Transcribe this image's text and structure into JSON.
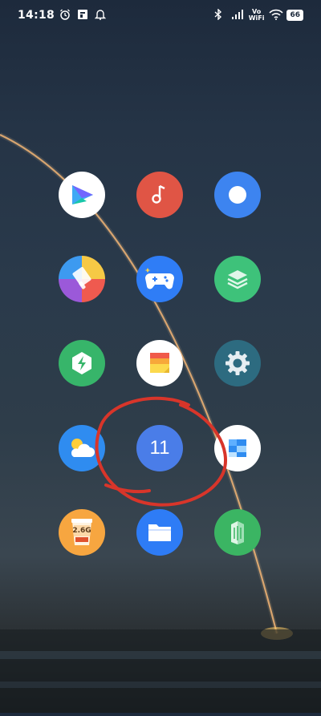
{
  "status_bar": {
    "time": "14:18",
    "vowifi_top": "Vo",
    "vowifi_bottom": "WiFi",
    "battery": "66"
  },
  "home": {
    "app_count": 15
  },
  "apps": {
    "calendar_date": "11",
    "cleaner_size": "2.6G"
  },
  "colors": {
    "annotation": "#d8352a",
    "calendar": "#4a7de8"
  }
}
